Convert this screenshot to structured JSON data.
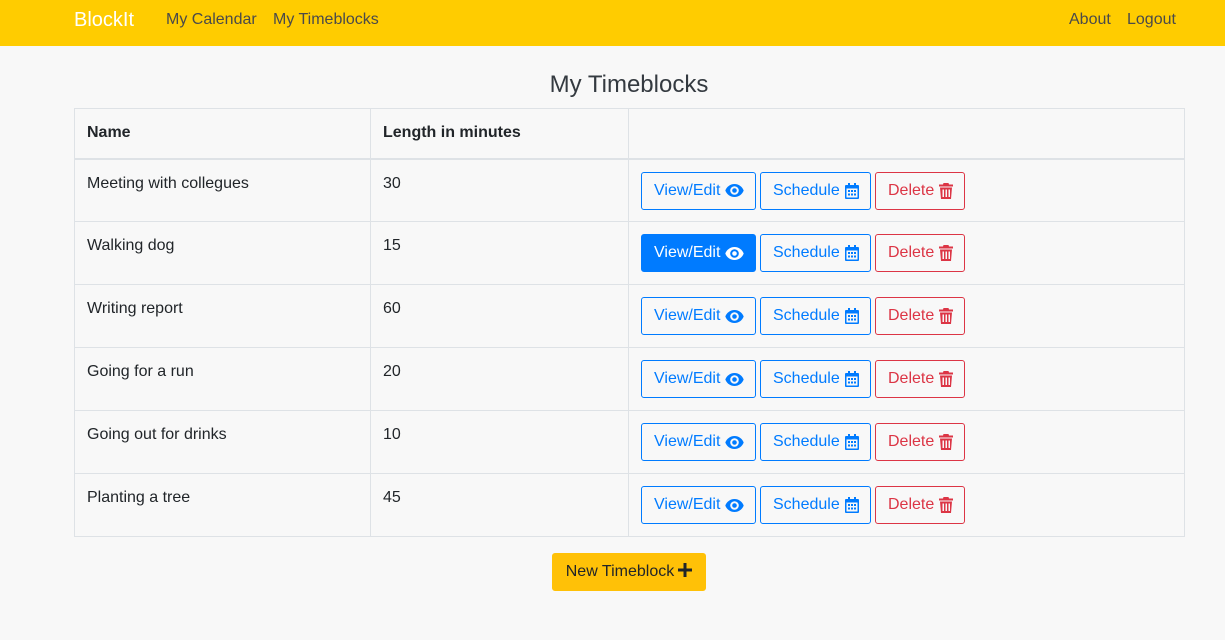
{
  "navbar": {
    "brand": "BlockIt",
    "left_links": [
      "My Calendar",
      "My Timeblocks"
    ],
    "right_links": [
      "About",
      "Logout"
    ]
  },
  "page": {
    "title": "My Timeblocks"
  },
  "table": {
    "headers": [
      "Name",
      "Length in minutes",
      ""
    ],
    "rows": [
      {
        "name": "Meeting with collegues",
        "length": "30"
      },
      {
        "name": "Walking dog",
        "length": "15"
      },
      {
        "name": "Writing report",
        "length": "60"
      },
      {
        "name": "Going for a run",
        "length": "20"
      },
      {
        "name": "Going out for drinks",
        "length": "10"
      },
      {
        "name": "Planting a tree",
        "length": "45"
      }
    ],
    "actions": {
      "view_label": "View/Edit",
      "schedule_label": "Schedule",
      "delete_label": "Delete",
      "view_icon": "eye-icon",
      "schedule_icon": "calendar-icon",
      "delete_icon": "trash-icon"
    },
    "active_view_row": 1
  },
  "new_button": {
    "label": "New Timeblock",
    "icon": "plus-icon"
  },
  "colors": {
    "navbar": "#ffcc00",
    "primary": "#007bff",
    "danger": "#dc3545",
    "warning": "#ffc107",
    "background": "#f8f8f8"
  }
}
